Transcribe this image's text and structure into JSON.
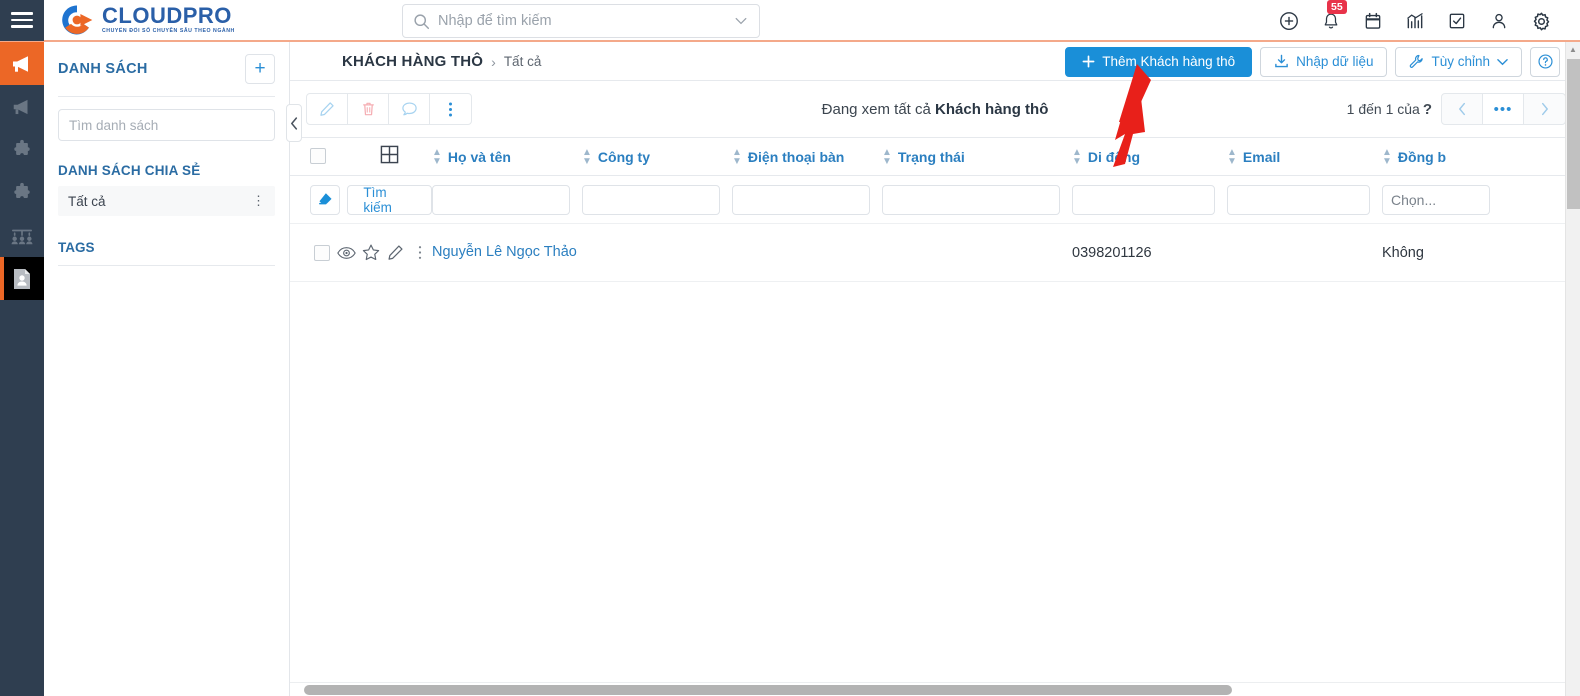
{
  "topbar": {
    "menu_icon": "hamburger-icon",
    "brand_name": "CLOUDPRO",
    "brand_tagline": "CHUYỂN ĐỔI SỐ CHUYÊN SÂU THEO NGÀNH",
    "search_placeholder": "Nhập để tìm kiếm",
    "search_value": "",
    "icons": [
      {
        "name": "add-circle-icon",
        "badge": ""
      },
      {
        "name": "bell-icon",
        "badge": "55"
      },
      {
        "name": "calendar-icon",
        "badge": ""
      },
      {
        "name": "analytics-icon",
        "badge": ""
      },
      {
        "name": "task-check-icon",
        "badge": ""
      },
      {
        "name": "user-icon",
        "badge": ""
      },
      {
        "name": "gear-icon",
        "badge": ""
      }
    ]
  },
  "rail": {
    "items": [
      {
        "name": "megaphone-active-icon",
        "state": "active-orange"
      },
      {
        "name": "megaphone-icon",
        "state": "normal"
      },
      {
        "name": "puzzle-icon",
        "state": "normal"
      },
      {
        "name": "puzzle-2-icon",
        "state": "normal"
      },
      {
        "name": "team-icon",
        "state": "normal"
      },
      {
        "name": "contact-card-icon",
        "state": "active-dark"
      }
    ]
  },
  "breadcrumb": {
    "main": "KHÁCH HÀNG THÔ",
    "separator": "›",
    "current": "Tất cả"
  },
  "actions": {
    "add_label": "Thêm Khách hàng thô",
    "add_icon": "plus-icon",
    "import_label": "Nhập dữ liệu",
    "import_icon": "download-icon",
    "customize_label": "Tùy chỉnh",
    "customize_icon": "wrench-icon",
    "customize_caret": "chevron-down-icon",
    "help_icon": "question-circle-icon"
  },
  "listpanel": {
    "title": "DANH SÁCH",
    "add_icon": "plus-icon",
    "search_placeholder": "Tìm danh sách",
    "search_value": "",
    "shared_title": "DANH SÁCH CHIA SẺ",
    "shared_items": [
      {
        "label": "Tất cả",
        "menu_icon": "kebab-vertical-icon"
      }
    ],
    "tags_title": "TAGS",
    "collapse_icon": "chevron-left-icon"
  },
  "toolbar": {
    "buttons": [
      {
        "name": "edit-icon"
      },
      {
        "name": "delete-icon"
      },
      {
        "name": "comment-icon"
      },
      {
        "name": "more-vertical-icon"
      }
    ],
    "viewing_prefix": "Đang xem tất cả ",
    "viewing_entity": "Khách hàng thô",
    "pager_text": "1 đến 1 của",
    "pager_unknown": "?",
    "pager_prev_icon": "chevron-left-icon",
    "pager_more": "•••",
    "pager_next_icon": "chevron-right-icon"
  },
  "table": {
    "columns": [
      {
        "key": "check",
        "label": "",
        "icon": "select-all-checkbox"
      },
      {
        "key": "grid",
        "label": "",
        "icon": "grid-view-icon"
      },
      {
        "key": "name",
        "label": "Họ và tên",
        "sortable": true
      },
      {
        "key": "company",
        "label": "Công ty",
        "sortable": true
      },
      {
        "key": "phone",
        "label": "Điện thoại bàn",
        "sortable": true
      },
      {
        "key": "status",
        "label": "Trạng thái",
        "sortable": true
      },
      {
        "key": "mobile",
        "label": "Di động",
        "sortable": true
      },
      {
        "key": "email",
        "label": "Email",
        "sortable": true
      },
      {
        "key": "sync",
        "label": "Đồng b",
        "sortable": true
      }
    ],
    "filter": {
      "clear_icon": "eraser-icon",
      "search_label": "Tìm kiếm",
      "name_value": "",
      "company_value": "",
      "phone_value": "",
      "status_value": "",
      "mobile_value": "",
      "email_value": "",
      "sync_placeholder": "Chọn..."
    },
    "rows": [
      {
        "checked": false,
        "tools": [
          "eye-icon",
          "star-icon",
          "edit-pencil-icon",
          "more-vertical-icon"
        ],
        "name": "Nguyễn Lê Ngọc Thảo",
        "company": "",
        "phone": "",
        "status": "",
        "mobile": "0398201126",
        "email": "",
        "sync": "Không"
      }
    ]
  },
  "colors": {
    "brand_blue": "#2a5fa8",
    "accent_orange": "#ec6726",
    "primary_button": "#1a8fd8",
    "link_blue": "#2b7fc0",
    "rail_dark": "#2f3e50",
    "badge_red": "#e8334a",
    "annotation_red": "#e8201a"
  }
}
